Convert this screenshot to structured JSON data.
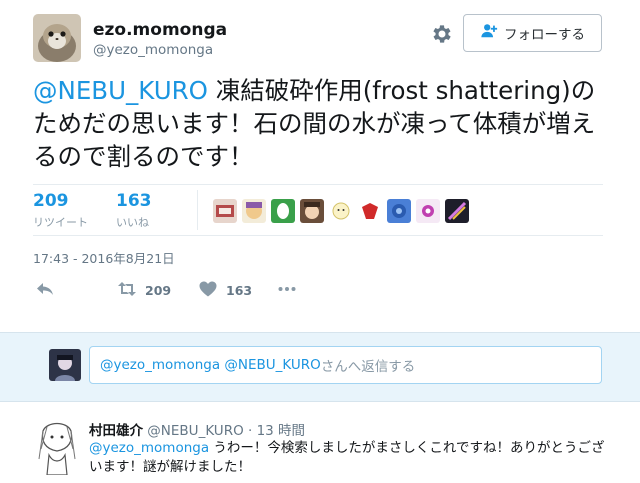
{
  "header": {
    "display_name": "ezo.momonga",
    "username": "@yezo_momonga",
    "follow_label": "フォローする",
    "settings_icon": "gear-icon",
    "follow_icon": "add-user-icon"
  },
  "tweet": {
    "mention": "@NEBU_KURO",
    "text": " 凍結破砕作用(frost shattering)のためだの思います！石の間の水が凍って体積が増えるので割るのです！"
  },
  "stats": {
    "retweets_count": "209",
    "retweets_label": "リツイート",
    "likes_count": "163",
    "likes_label": "いいね"
  },
  "timestamp": "17:43 - 2016年8月21日",
  "actions": {
    "reply_icon": "reply-icon",
    "retweet_icon": "retweet-icon",
    "retweet_count": "209",
    "like_icon": "heart-icon",
    "like_count": "163",
    "more_icon": "more-icon"
  },
  "reply_box": {
    "mentions": "@yezo_momonga @NEBU_KURO",
    "placeholder_text": "さんへ返信する"
  },
  "reply": {
    "name": "村田雄介",
    "handle": "@NEBU_KURO · 13 時間",
    "mention": "@yezo_momonga",
    "text": " うわー！今検索しましたがまさしくこれですね！ありがとうございます！謎が解けました！"
  },
  "colors": {
    "link": "#1b95e0",
    "secondary_text": "#657786",
    "reply_bg": "#e8f4fb"
  }
}
